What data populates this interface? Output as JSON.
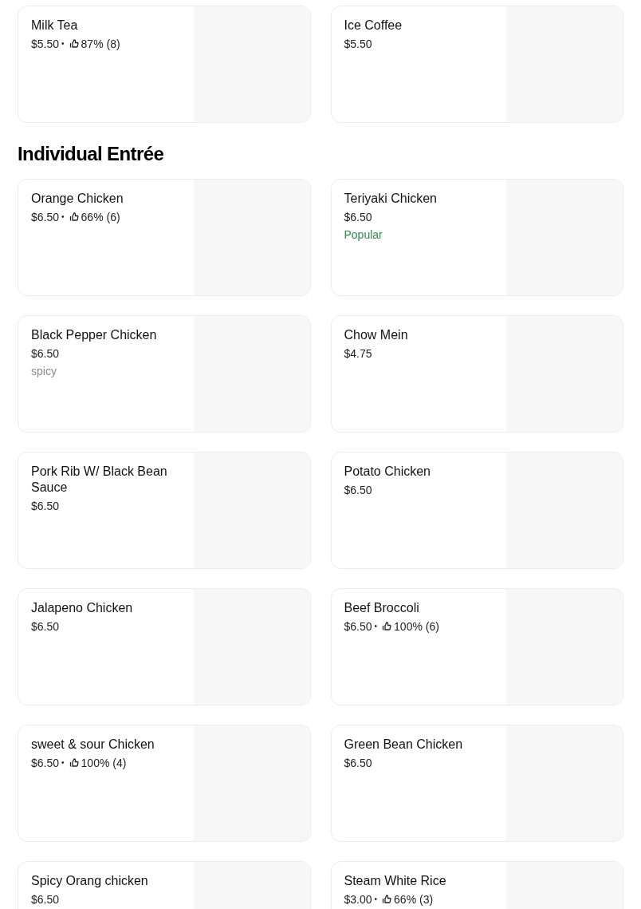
{
  "top_items": [
    {
      "name": "Milk Tea",
      "price": "$5.50",
      "rating": {
        "separator": "•",
        "text": "87% (8)"
      }
    },
    {
      "name": "Ice Coffee",
      "price": "$5.50"
    }
  ],
  "sections": [
    {
      "title": "Individual Entrée",
      "items": [
        {
          "name": "Orange Chicken",
          "price": "$6.50",
          "rating": {
            "separator": "•",
            "text": "66% (6)"
          }
        },
        {
          "name": "Teriyaki Chicken",
          "price": "$6.50",
          "tag": {
            "kind": "popular",
            "text": "Popular"
          }
        },
        {
          "name": "Black Pepper Chicken",
          "price": "$6.50",
          "tag": {
            "kind": "note",
            "text": "spicy"
          }
        },
        {
          "name": "Chow Mein",
          "price": "$4.75"
        },
        {
          "name": "Pork Rib W/ Black Bean Sauce",
          "price": "$6.50"
        },
        {
          "name": "Potato Chicken",
          "price": "$6.50"
        },
        {
          "name": "Jalapeno Chicken",
          "price": "$6.50"
        },
        {
          "name": "Beef Broccoli",
          "price": "$6.50",
          "rating": {
            "separator": "•",
            "text": "100% (6)"
          }
        },
        {
          "name": "sweet & sour Chicken",
          "price": "$6.50",
          "rating": {
            "separator": "•",
            "text": "100% (4)"
          }
        },
        {
          "name": "Green Bean Chicken",
          "price": "$6.50"
        },
        {
          "name": "Spicy Orang chicken",
          "price": "$6.50"
        },
        {
          "name": "Steam White Rice",
          "price": "$3.00",
          "rating": {
            "separator": "•",
            "text": "66% (3)"
          }
        }
      ]
    }
  ]
}
